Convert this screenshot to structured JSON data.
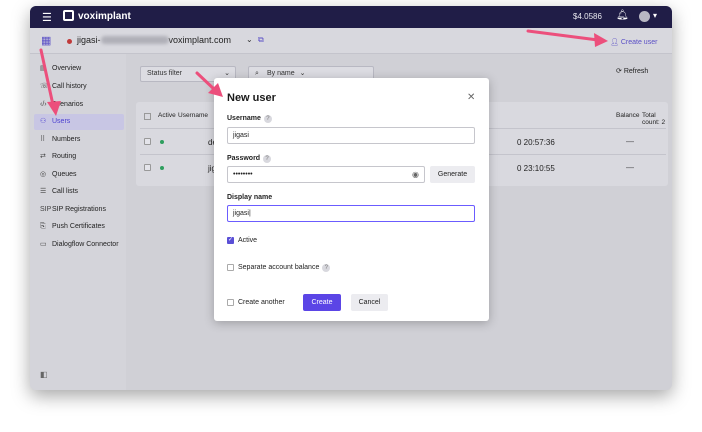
{
  "topbar": {
    "brand": "voximplant",
    "balance": "$4.0586"
  },
  "subbar": {
    "account_prefix": "jigasi-",
    "account_suffix": "voximplant.com",
    "create_user_label": "Create user"
  },
  "sidebar": {
    "items": [
      {
        "label": "Overview",
        "icon": "overview-icon"
      },
      {
        "label": "Call history",
        "icon": "call-history-icon"
      },
      {
        "label": "Scenarios",
        "icon": "code-icon"
      },
      {
        "label": "Users",
        "icon": "users-icon"
      },
      {
        "label": "Numbers",
        "icon": "numbers-icon"
      },
      {
        "label": "Routing",
        "icon": "routing-icon"
      },
      {
        "label": "Queues",
        "icon": "queues-icon"
      },
      {
        "label": "Call lists",
        "icon": "list-icon"
      },
      {
        "label": "SIP Registrations",
        "icon": "sip-icon"
      },
      {
        "label": "Push Certificates",
        "icon": "certificate-icon"
      },
      {
        "label": "Dialogflow Connector",
        "icon": "chat-icon"
      }
    ]
  },
  "filters": {
    "status_filter": "Status filter",
    "by_name": "By name",
    "refresh": "Refresh"
  },
  "table": {
    "headers": {
      "active": "Active",
      "username": "Username",
      "balance": "Balance",
      "total_count": "Total count: 2"
    },
    "rows": [
      {
        "username": "desktop",
        "time": "0 20:57:36",
        "balance": "—"
      },
      {
        "username": "jigasi",
        "time": "0 23:10:55",
        "balance": "—"
      }
    ]
  },
  "modal": {
    "title": "New user",
    "username_label": "Username",
    "username_value": "jigasi",
    "password_label": "Password",
    "password_value": "••••••••",
    "generate_label": "Generate",
    "display_name_label": "Display name",
    "display_name_value": "jigasi|",
    "active_label": "Active",
    "separate_balance_label": "Separate account balance",
    "create_another_label": "Create another",
    "create_label": "Create",
    "cancel_label": "Cancel"
  },
  "colors": {
    "accent": "#5b45e6",
    "topbar": "#201d47",
    "arrow": "#ec4f7c"
  }
}
